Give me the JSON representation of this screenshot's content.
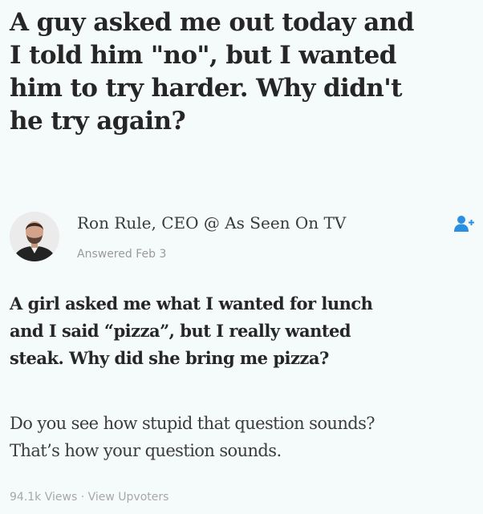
{
  "question": {
    "lines": [
      "A guy asked me out today and",
      "I told him \"no\", but I wanted",
      "him to try harder. Why didn't",
      "he try again?"
    ]
  },
  "answer": {
    "author": "Ron Rule, CEO @ As Seen On TV",
    "answered_label": "Answered Feb 3",
    "follow_icon": "add-user-icon",
    "bold_lines": [
      "A girl asked me what I wanted for lunch",
      "and I said “pizza”, but I really wanted",
      "steak. Why did she bring me pizza?"
    ],
    "plain_lines": [
      "Do you see how stupid that question sounds?",
      "That’s how your question sounds."
    ]
  },
  "footer": {
    "views": "94.1k Views",
    "separator": " · ",
    "upvoters": "View Upvoters"
  },
  "colors": {
    "background": "#f5fafa",
    "follow_icon": "#2a8fe0",
    "meta_text": "#9a9a9a"
  }
}
